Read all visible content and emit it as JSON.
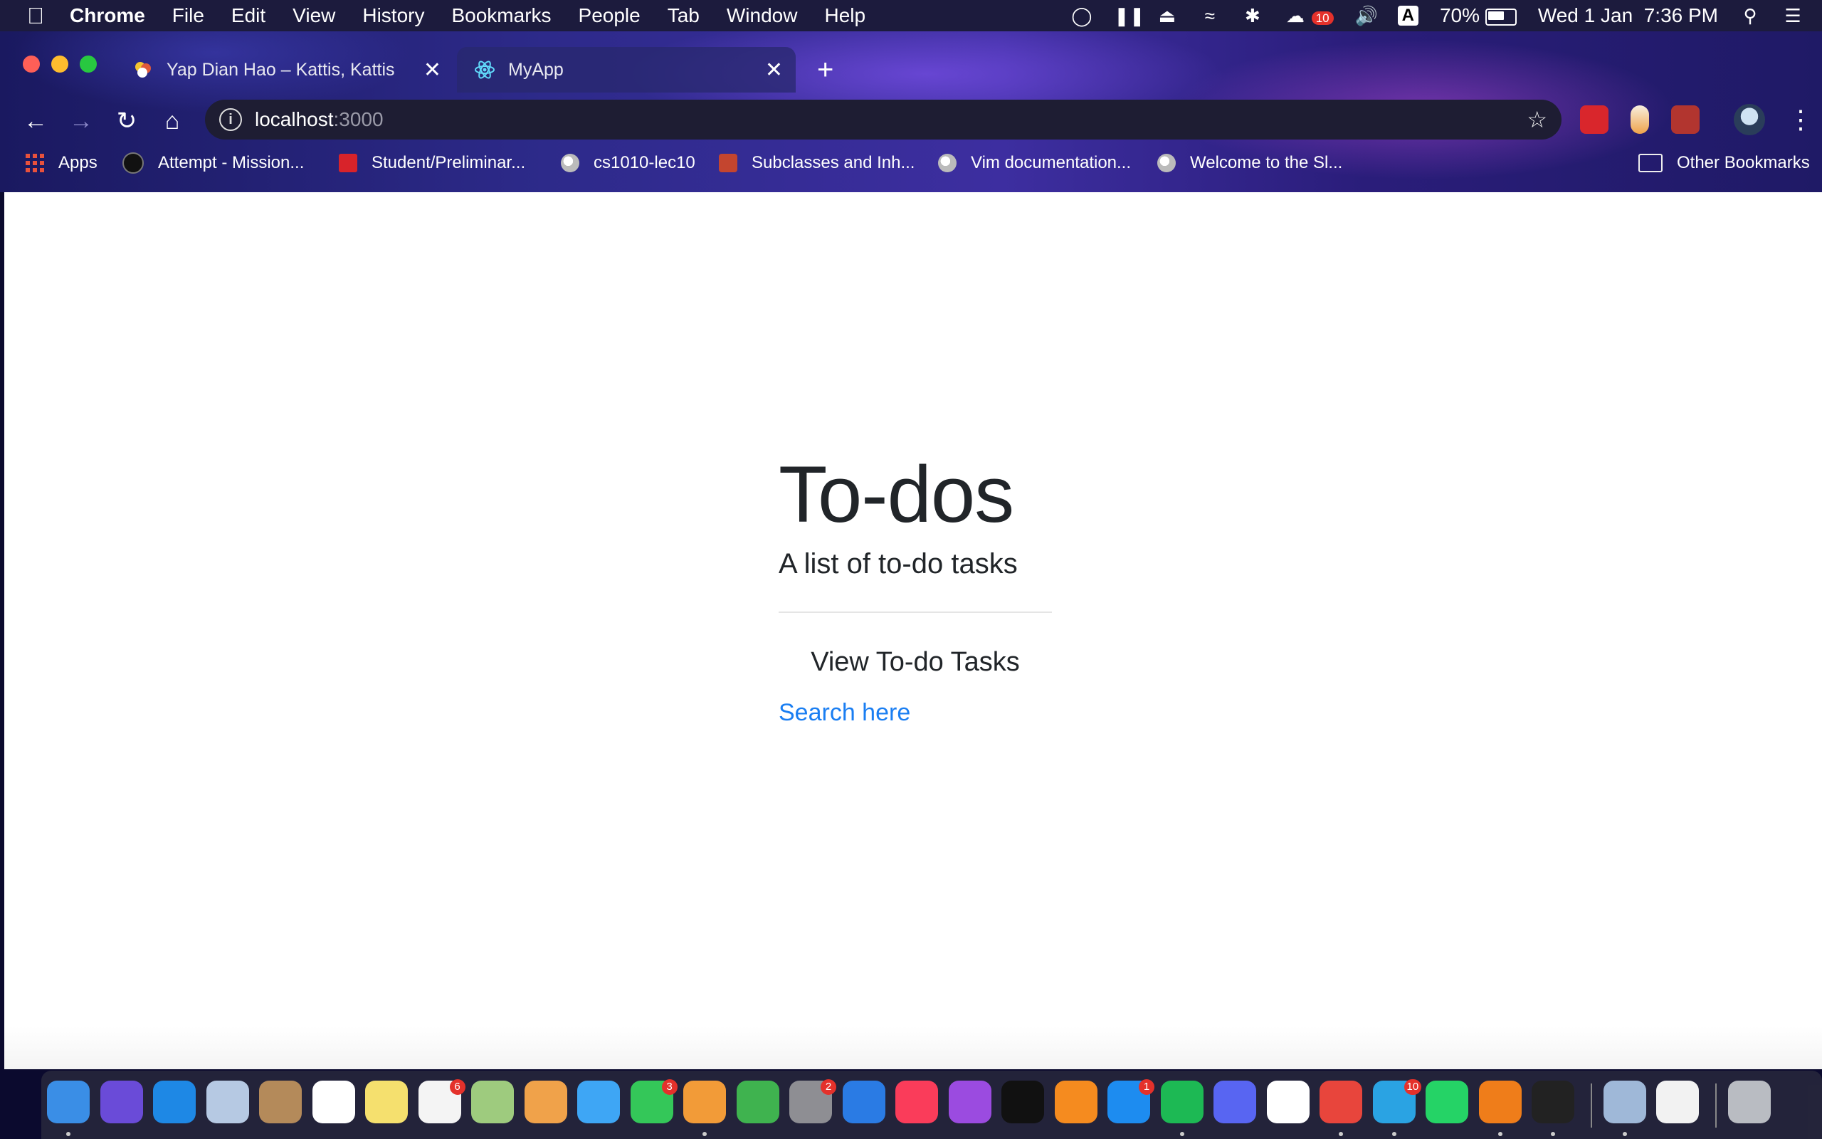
{
  "menubar": {
    "app": "Chrome",
    "items": [
      "File",
      "Edit",
      "View",
      "History",
      "Bookmarks",
      "People",
      "Tab",
      "Window",
      "Help"
    ],
    "status": {
      "notification_badge": "10",
      "keyboard_input": "A",
      "battery_percent": "70%",
      "battery_level": 0.7,
      "datetime": "Wed 1 Jan  7:36 PM"
    }
  },
  "tabs": [
    {
      "title": "Yap Dian Hao – Kattis, Kattis",
      "active": false
    },
    {
      "title": "MyApp",
      "active": true
    }
  ],
  "address": {
    "host": "localhost",
    "port": ":3000"
  },
  "bookmarks": [
    {
      "label": "Apps",
      "icon": "apps-grid-icon"
    },
    {
      "label": "Attempt - Mission...",
      "icon": "mission-icon"
    },
    {
      "label": "Student/Preliminar...",
      "icon": "oracle-icon"
    },
    {
      "label": "cs1010-lec10",
      "icon": "globe-icon"
    },
    {
      "label": "Subclasses and Inh...",
      "icon": "bug-icon"
    },
    {
      "label": "Vim documentation...",
      "icon": "globe-icon"
    },
    {
      "label": "Welcome to the Sl...",
      "icon": "globe-icon"
    },
    {
      "label": "Other Bookmarks",
      "icon": "folder-icon"
    }
  ],
  "page": {
    "title": "To-dos",
    "lead": "A list of to-do tasks",
    "section_heading": "View To-do Tasks",
    "search_link": "Search here"
  },
  "dock": {
    "apps": [
      {
        "name": "finder",
        "color": "#3a8ee6",
        "running": true
      },
      {
        "name": "siri",
        "color": "#6a4bd8",
        "running": false
      },
      {
        "name": "safari",
        "color": "#1e88e5",
        "running": false
      },
      {
        "name": "mail-bird",
        "color": "#b6c9e3",
        "running": false
      },
      {
        "name": "contacts",
        "color": "#b48a5a",
        "running": false
      },
      {
        "name": "calendar",
        "color": "#ffffff",
        "running": false
      },
      {
        "name": "notes",
        "color": "#f5e06e",
        "running": false
      },
      {
        "name": "reminders",
        "color": "#f4f4f4",
        "badge": "6",
        "running": false
      },
      {
        "name": "maps",
        "color": "#9ecb7e",
        "running": false
      },
      {
        "name": "photos",
        "color": "#f0a24a",
        "running": false
      },
      {
        "name": "messages",
        "color": "#3ea6f5",
        "running": false
      },
      {
        "name": "facetime",
        "color": "#34c759",
        "badge": "3",
        "running": false
      },
      {
        "name": "pages",
        "color": "#f29b38",
        "running": true
      },
      {
        "name": "numbers",
        "color": "#3fb34f",
        "running": false
      },
      {
        "name": "system-preferences",
        "color": "#8e8e93",
        "badge": "2",
        "running": false
      },
      {
        "name": "keynote",
        "color": "#2a7be4",
        "running": false
      },
      {
        "name": "music",
        "color": "#fa3c5a",
        "running": false
      },
      {
        "name": "podcasts",
        "color": "#9b4be0",
        "running": false
      },
      {
        "name": "apple-tv",
        "color": "#111111",
        "running": false
      },
      {
        "name": "books",
        "color": "#f58b1f",
        "running": false
      },
      {
        "name": "app-store",
        "color": "#1d8cf0",
        "badge": "1",
        "running": false
      },
      {
        "name": "spotify",
        "color": "#1db954",
        "running": true
      },
      {
        "name": "discord",
        "color": "#5865f2",
        "running": false
      },
      {
        "name": "slack",
        "color": "#ffffff",
        "running": false
      },
      {
        "name": "chrome",
        "color": "#e8453c",
        "running": true
      },
      {
        "name": "telegram",
        "color": "#2aa3e3",
        "badge": "10",
        "running": true
      },
      {
        "name": "whatsapp",
        "color": "#25d366",
        "running": false
      },
      {
        "name": "sublime-text",
        "color": "#ef7d1a",
        "running": true
      },
      {
        "name": "terminal",
        "color": "#222222",
        "running": true
      },
      {
        "name": "preview",
        "color": "#9fb8d8",
        "running": true
      },
      {
        "name": "textedit",
        "color": "#f2f2f2",
        "running": false
      },
      {
        "name": "trash",
        "color": "#b9bcc2",
        "running": false
      }
    ]
  }
}
